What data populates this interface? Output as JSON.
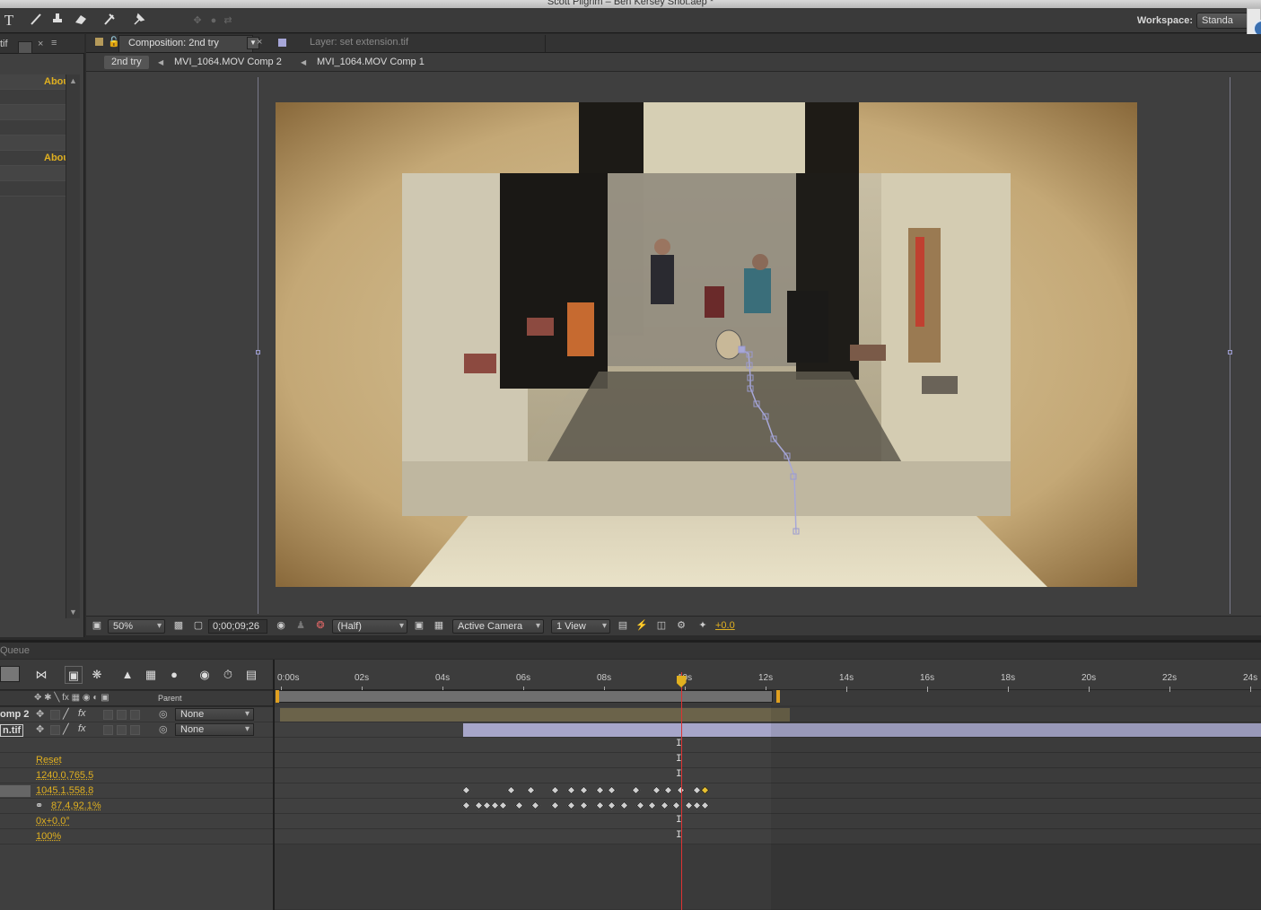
{
  "window": {
    "title": "Scott Pilgrim – Ben Kersey Shot.aep *"
  },
  "toolbar": {
    "tools": [
      "type-tool",
      "brush-tool",
      "clone-stamp-tool",
      "eraser-tool",
      "roto-brush-tool",
      "puppet-pin-tool"
    ],
    "type_glyph": "T",
    "workspace_label": "Workspace:",
    "workspace_value": "Standa"
  },
  "project_panel": {
    "tab_text": "tif",
    "about_1": "Abou",
    "about_2": "Abou"
  },
  "composition_panel": {
    "tab_label": "Composition: 2nd try",
    "layer_tab_label": "Layer: set extension.tif",
    "breadcrumbs": [
      "2nd try",
      "MVI_1064.MOV Comp 2",
      "MVI_1064.MOV Comp 1"
    ]
  },
  "viewer_controls": {
    "magnification": "50%",
    "timecode": "0;00;09;26",
    "resolution": "(Half)",
    "view": "Active Camera",
    "layout": "1 View",
    "exposure": "+0.0"
  },
  "timeline": {
    "panel_tab": "Queue",
    "parent_header": "Parent",
    "time_labels": [
      "0:00s",
      "02s",
      "04s",
      "06s",
      "08s",
      "10s",
      "12s",
      "14s",
      "16s",
      "18s",
      "20s",
      "22s",
      "24s"
    ],
    "current_time_seconds": 9.9,
    "work_area_seconds": [
      0,
      12.3
    ],
    "layers": [
      {
        "name": "omp 2",
        "parent": "None"
      },
      {
        "name": "n.tif",
        "parent": "None"
      }
    ],
    "properties": [
      {
        "value": "Reset"
      },
      {
        "value": "1240.0,765.5"
      },
      {
        "value": "1045.1,558.8"
      },
      {
        "value": "87.4,92.1%"
      },
      {
        "value": "0x+0.0°"
      },
      {
        "value": "100%"
      }
    ],
    "keyframes_position_seconds": [
      4.6,
      5.7,
      6.2,
      6.8,
      7.2,
      7.5,
      7.9,
      8.2,
      8.8,
      9.3,
      9.6,
      9.9,
      10.3,
      10.5
    ],
    "keyframes_scale_seconds": [
      4.6,
      4.9,
      5.1,
      5.3,
      5.5,
      5.9,
      6.3,
      6.8,
      7.2,
      7.5,
      7.9,
      8.2,
      8.5,
      8.9,
      9.2,
      9.5,
      9.8,
      10.1,
      10.3,
      10.5
    ]
  }
}
